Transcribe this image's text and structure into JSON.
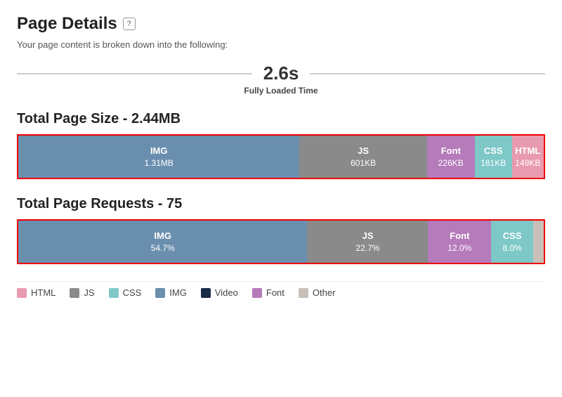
{
  "header": {
    "title": "Page Details",
    "help_label": "?",
    "subtitle": "Your page content is broken down into the following:"
  },
  "time_block": {
    "value": "2.6s",
    "label": "Fully Loaded Time"
  },
  "size_section": {
    "title": "Total Page Size - 2.44MB",
    "segments": [
      {
        "label": "IMG",
        "value": "1.31MB",
        "color": "#6a8fae",
        "flex": 53,
        "dark_text": false
      },
      {
        "label": "JS",
        "value": "601KB",
        "color": "#8a8a8a",
        "flex": 24,
        "dark_text": false
      },
      {
        "label": "Font",
        "value": "226KB",
        "color": "#b57bba",
        "flex": 9,
        "dark_text": false
      },
      {
        "label": "CSS",
        "value": "181KB",
        "color": "#7ec8c8",
        "flex": 7,
        "dark_text": false
      },
      {
        "label": "HTML",
        "value": "149KB",
        "color": "#e89bb0",
        "flex": 6,
        "dark_text": false
      }
    ]
  },
  "requests_section": {
    "title": "Total Page Requests - 75",
    "segments": [
      {
        "label": "IMG",
        "value": "54.7%",
        "color": "#6a8fae",
        "flex": 55,
        "dark_text": false
      },
      {
        "label": "JS",
        "value": "22.7%",
        "color": "#8a8a8a",
        "flex": 23,
        "dark_text": false
      },
      {
        "label": "Font",
        "value": "12.0%",
        "color": "#b57bba",
        "flex": 12,
        "dark_text": false
      },
      {
        "label": "CSS",
        "value": "8.0%",
        "color": "#7ec8c8",
        "flex": 8,
        "dark_text": false
      },
      {
        "label": "",
        "value": "",
        "color": "#c8c0b8",
        "flex": 2,
        "dark_text": false
      }
    ]
  },
  "legend": {
    "items": [
      {
        "label": "HTML",
        "color": "#e89bb0"
      },
      {
        "label": "JS",
        "color": "#8a8a8a"
      },
      {
        "label": "CSS",
        "color": "#7ec8c8"
      },
      {
        "label": "IMG",
        "color": "#6a8fae"
      },
      {
        "label": "Video",
        "color": "#1a2a4a"
      },
      {
        "label": "Font",
        "color": "#b57bba"
      },
      {
        "label": "Other",
        "color": "#c8c0b8"
      }
    ]
  }
}
